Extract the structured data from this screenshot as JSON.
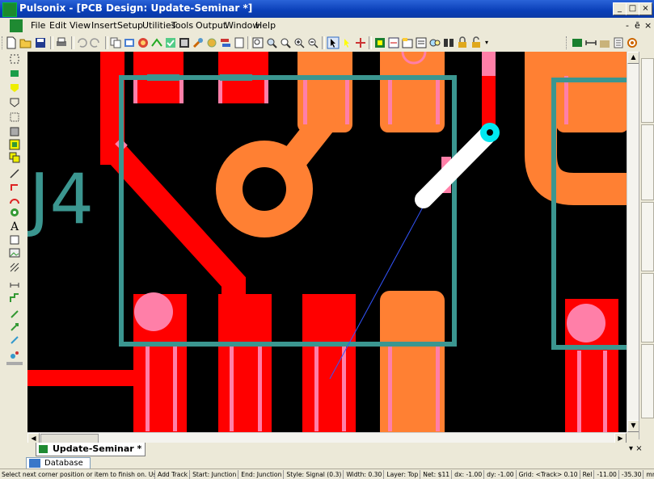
{
  "window": {
    "title": "Pulsonix - [PCB Design: Update-Seminar *]",
    "controls": [
      "_",
      "□",
      "×"
    ]
  },
  "menu": [
    "File",
    "Edit",
    "View",
    "Insert",
    "Setup",
    "Utilities",
    "Tools",
    "Output",
    "Window",
    "Help"
  ],
  "mdi_controls": [
    "-",
    "ē",
    "×"
  ],
  "canvas": {
    "component_label": "J4",
    "colors": {
      "red": "#ff0000",
      "orange": "#ff8033",
      "pink": "#ff7fa8",
      "teal": "#3b9690",
      "background": "#000000",
      "cyan": "#00e8f0",
      "ratsnest": "#3355ff"
    }
  },
  "tabs": {
    "document": "Update-Seminar *",
    "database": "Database",
    "right_glyph": "▾ ×"
  },
  "status": {
    "fields": [
      "Select next corner position or item to finish on.  Use 'Ctrl+",
      "Add Track",
      "Start: Junction",
      "End: Junction",
      "Style: Signal (0.3)",
      "Width: 0.30",
      "Layer: Top",
      "Net: $11",
      "dx: -1.00",
      "dy: -1.00",
      "Grid: <Track> 0.10",
      "Rel",
      "-11.00",
      "-35.30",
      "mm"
    ]
  }
}
